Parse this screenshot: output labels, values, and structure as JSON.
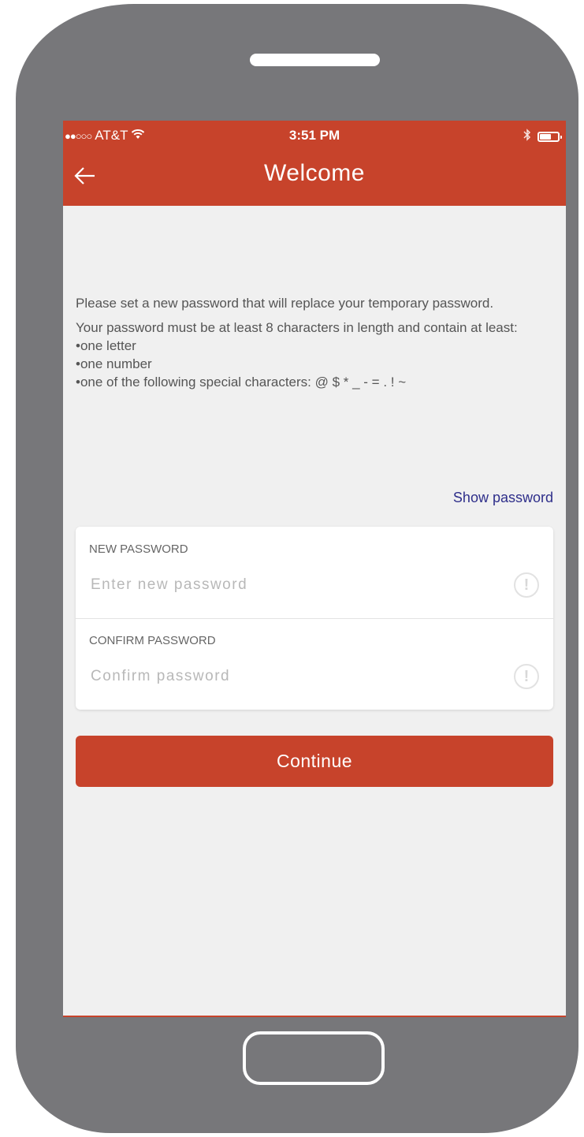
{
  "status_bar": {
    "signal": "●●○○○",
    "carrier": "AT&T",
    "time": "3:51 PM",
    "wifi_icon": "wifi-icon",
    "bluetooth_icon": "bluetooth-icon",
    "battery_icon": "battery-icon"
  },
  "header": {
    "back_icon": "arrow-left-icon",
    "title": "Welcome",
    "color": "#c7432b"
  },
  "instructions": {
    "intro": "Please set a new password that will replace your temporary password.",
    "requirements_intro": "Your password must be at least 8 characters in length and contain at least:",
    "requirements": [
      "one letter",
      "one number",
      "one of the following special characters: @ $ * _ - = . ! ~"
    ]
  },
  "show_password_label": "Show password",
  "form": {
    "new_password": {
      "label": "NEW PASSWORD",
      "placeholder": "Enter new password",
      "value": ""
    },
    "confirm_password": {
      "label": "CONFIRM PASSWORD",
      "placeholder": "Confirm password",
      "value": ""
    }
  },
  "continue_label": "Continue",
  "accent_color": "#c7432b",
  "link_color": "#2e2e8a"
}
